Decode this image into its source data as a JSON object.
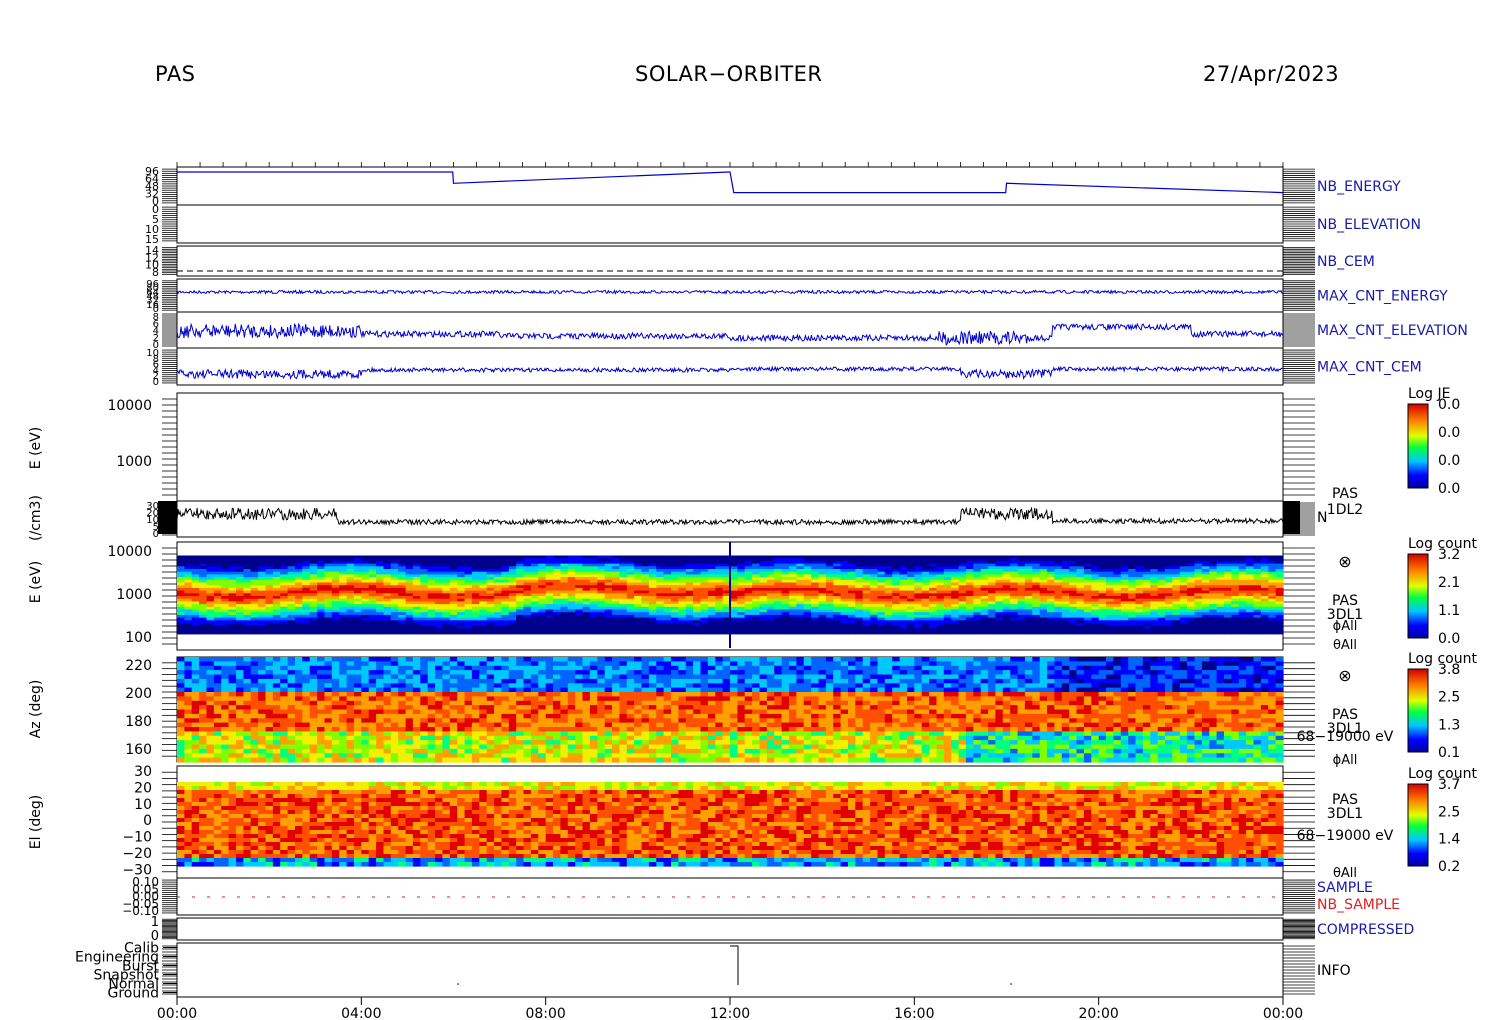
{
  "header": {
    "left": "PAS",
    "center": "SOLAR−ORBITER",
    "right": "27/Apr/2023"
  },
  "colors": {
    "blue_trace": "#0000cc",
    "red_trace": "#dd2222",
    "black_trace": "#000000"
  },
  "chart_data": [
    {
      "type": "line",
      "name_label": "NB_ENERGY",
      "label_color": "#1a1aaa",
      "ytick_labels": [
        "96",
        "64",
        "48",
        "32",
        "0"
      ],
      "series": [
        {
          "x": [
            "00:00",
            "05:59",
            "06:00",
            "11:59",
            "12:00",
            "12:05",
            "17:59",
            "18:00",
            "24:00"
          ],
          "values": [
            96,
            96,
            60,
            96,
            96,
            30,
            30,
            60,
            30
          ]
        }
      ]
    },
    {
      "type": "line",
      "name_label": "NB_ELEVATION",
      "label_color": "#1a1aaa",
      "ytick_labels": [
        "0",
        "5",
        "10",
        "15"
      ],
      "series": []
    },
    {
      "type": "line",
      "name_label": "NB_CEM",
      "label_color": "#1a1aaa",
      "ytick_labels": [
        "14",
        "12",
        "10",
        "8"
      ],
      "series": []
    },
    {
      "type": "line",
      "name_label": "MAX_CNT_ENERGY",
      "label_color": "#1a1aaa",
      "ytick_labels": [
        "96",
        "80",
        "64",
        "48",
        "32",
        "16",
        "0"
      ],
      "series": []
    },
    {
      "type": "line",
      "name_label": "MAX_CNT_ELEVATION",
      "label_color": "#1a1aaa",
      "ytick_labels": [
        "8",
        "6",
        "4",
        "2",
        "0"
      ],
      "series": []
    },
    {
      "type": "line",
      "name_label": "MAX_CNT_CEM",
      "label_color": "#1a1aaa",
      "ytick_labels": [
        "10",
        "8",
        "6",
        "4",
        "2",
        "0"
      ],
      "series": []
    },
    {
      "type": "heatmap",
      "ylabel": "E (eV)",
      "yticks": [
        "10000",
        "1000"
      ],
      "colorbar": {
        "title": "Log JE",
        "ticks": [
          "0.0",
          "0.0",
          "0.0",
          "0.0"
        ]
      }
    },
    {
      "type": "line",
      "ylabel": "(/cm3)",
      "ytick_labels": [
        "30",
        "20",
        "10",
        "5",
        "0"
      ],
      "right_labels": [
        "PAS",
        "1DL2",
        "N"
      ]
    },
    {
      "type": "heatmap",
      "ylabel": "E (eV)",
      "yticks": [
        "10000",
        "1000",
        "100"
      ],
      "right_labels": [
        "⊗",
        "PAS",
        "3DL1",
        "ϕAll",
        "θAll"
      ],
      "colorbar": {
        "title": "Log count",
        "ticks": [
          "3.2",
          "2.1",
          "1.1",
          "0.0"
        ]
      }
    },
    {
      "type": "heatmap",
      "ylabel": "Az (deg)",
      "yticks": [
        "220",
        "200",
        "180",
        "160"
      ],
      "right_labels": [
        "⊗",
        "PAS",
        "3DL1",
        "68−19000 eV",
        "ϕAll"
      ],
      "colorbar": {
        "title": "Log count",
        "ticks": [
          "3.8",
          "2.5",
          "1.3",
          "0.1"
        ]
      }
    },
    {
      "type": "heatmap",
      "ylabel": "El (deg)",
      "yticks": [
        "30",
        "20",
        "10",
        "0",
        "−10",
        "−20",
        "−30"
      ],
      "right_labels": [
        "PAS",
        "3DL1",
        "68−19000 eV",
        "θAll"
      ],
      "colorbar": {
        "title": "Log count",
        "ticks": [
          "3.7",
          "2.5",
          "1.4",
          "0.2"
        ]
      }
    },
    {
      "type": "line",
      "ytick_labels": [
        "0.10",
        "0.05",
        "0.00",
        "−0.05",
        "−0.10"
      ],
      "right_labels": [
        {
          "text": "SAMPLE",
          "color": "#1a1aaa"
        },
        {
          "text": "NB_SAMPLE",
          "color": "#dd2222"
        }
      ]
    },
    {
      "type": "line",
      "name_label": "COMPRESSED",
      "label_color": "#1a1aaa",
      "ytick_labels": [
        "1",
        "0"
      ]
    },
    {
      "type": "line",
      "name_label": "INFO",
      "label_color": "#000000",
      "ytick_labels": [
        "Calib",
        "Engineering",
        "Burst",
        "Snapshot",
        "Normal",
        "Ground"
      ],
      "series": [
        {
          "x": [
            "00:00",
            "12:00",
            "12:10",
            "24:00"
          ],
          "values": [
            "Ground",
            "Calib",
            "Normal",
            "Normal"
          ]
        }
      ]
    }
  ],
  "x_axis": {
    "tick_labels": [
      "00:00",
      "04:00",
      "08:00",
      "12:00",
      "16:00",
      "20:00",
      "00:00"
    ]
  }
}
